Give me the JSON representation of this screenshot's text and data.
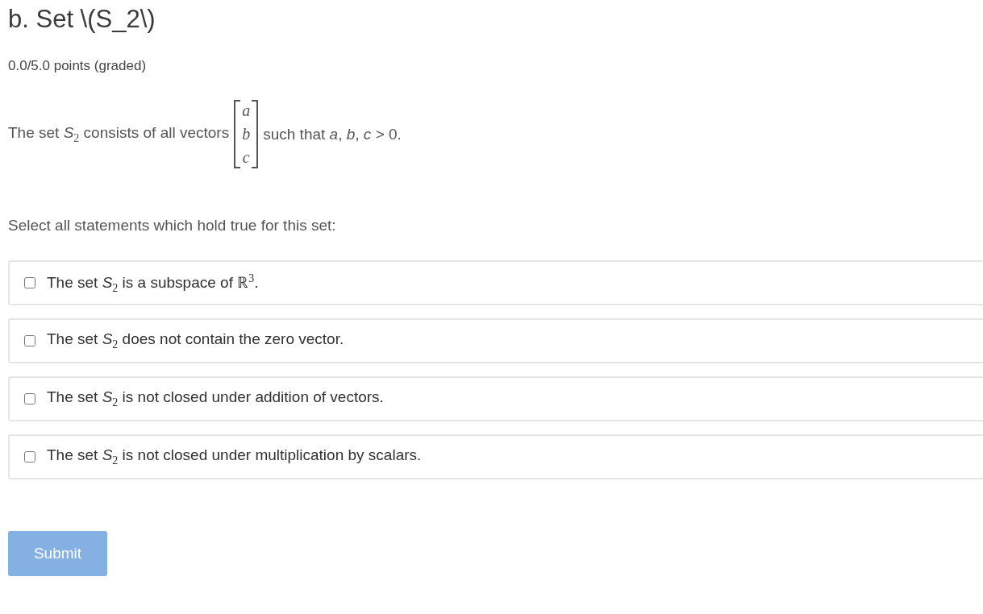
{
  "title": "b. Set \\(S_2\\)",
  "points": "0.0/5.0 points (graded)",
  "prompt": {
    "before": "The set *S*$_{2}$ consists of all vectors",
    "vector": [
      "a",
      "b",
      "c"
    ],
    "after": "such that *a*, *b*, *c* > 0."
  },
  "instruction": "Select all statements which hold true for this set:",
  "options": [
    {
      "label": "The set *S*$_{2}$ is a subspace of ℝ$^{3}$.",
      "checked": false
    },
    {
      "label": "The set *S*$_{2}$ does not contain the zero vector.",
      "checked": false
    },
    {
      "label": "The set *S*$_{2}$ is not closed under addition of vectors.",
      "checked": false
    },
    {
      "label": "The set *S*$_{2}$ is not closed under multiplication by scalars.",
      "checked": false
    }
  ],
  "submit": {
    "label": "Submit",
    "disabled": true
  }
}
